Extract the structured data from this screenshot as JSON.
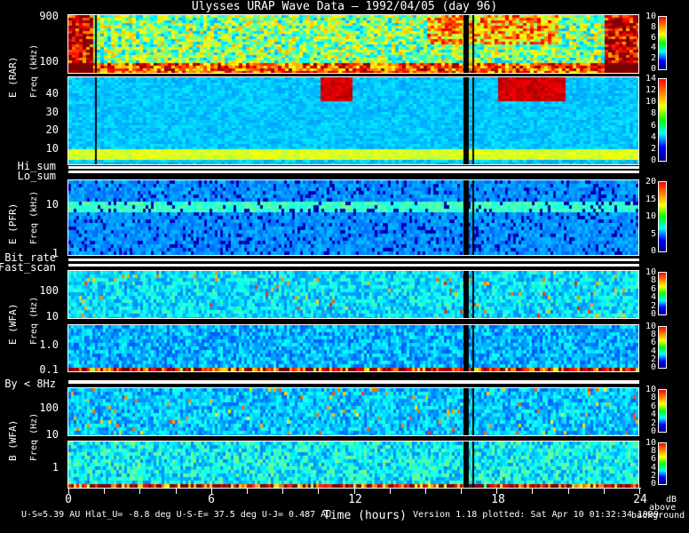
{
  "chart_data": {
    "type": "heatmap",
    "title": "Ulysses URAP Wave Data — 1992/04/05  (day 96)",
    "xlabel": "Time (hours)",
    "xlim": [
      0,
      24
    ],
    "xticks": [
      "0",
      "6",
      "12",
      "18",
      "24"
    ],
    "panels": [
      {
        "id": "rar-high",
        "group": "E (RAR)",
        "ylabel": "Freq (kHz)",
        "yticks": [
          "900",
          "100"
        ],
        "colorbar": [
          "10",
          "8",
          "6",
          "4",
          "2",
          "0"
        ],
        "cmax": 10
      },
      {
        "id": "rar-low",
        "group": "E (RAR)",
        "ylabel": "Freq (kHz)",
        "yticks": [
          "40",
          "30",
          "20",
          "10"
        ],
        "colorbar": [
          "14",
          "12",
          "10",
          "8",
          "6",
          "4",
          "2",
          "0"
        ],
        "cmax": 14
      },
      {
        "id": "pfr",
        "group": "E (PFR)",
        "ylabel": "Freq (kHz)",
        "yticks": [
          "10",
          "1"
        ],
        "colorbar": [
          "20",
          "15",
          "10",
          "5",
          "0"
        ],
        "cmax": 20
      },
      {
        "id": "wfa-e-high",
        "group": "E (WFA)",
        "ylabel": "Freq (Hz)",
        "yticks": [
          "100",
          "10"
        ],
        "colorbar": [
          "10",
          "8",
          "6",
          "4",
          "2",
          "0"
        ],
        "cmax": 10
      },
      {
        "id": "wfa-e-low",
        "group": "E (WFA)",
        "ylabel": "Freq (Hz)",
        "yticks": [
          "1.0",
          "0.1"
        ],
        "colorbar": [
          "10",
          "8",
          "6",
          "4",
          "2",
          "0"
        ],
        "cmax": 10
      },
      {
        "id": "wfa-b-high",
        "group": "B (WFA)",
        "ylabel": "Freq (Hz)",
        "yticks": [
          "100",
          "10"
        ],
        "colorbar": [
          "10",
          "8",
          "6",
          "4",
          "2",
          "0"
        ],
        "cmax": 10
      },
      {
        "id": "wfa-b-low",
        "group": "B (WFA)",
        "ylabel": "Freq (Hz)",
        "yticks": [
          "1"
        ],
        "colorbar": [
          "10",
          "8",
          "6",
          "4",
          "2",
          "0"
        ],
        "cmax": 10
      }
    ],
    "strips": [
      "Hi_sum",
      "Lo_sum",
      "Bit_rate",
      "Fast_scan",
      "By < 8Hz"
    ],
    "colorbar_unit": [
      "dB",
      "above",
      "background"
    ]
  },
  "footer": {
    "orbit": "U-S=5.39 AU  Hlat_U= -8.8 deg  U-S-E= 37.5 deg  U-J= 0.487 AU",
    "version": "Version 1.18 plotted: Sat Apr 10 01:32:34 1999"
  }
}
